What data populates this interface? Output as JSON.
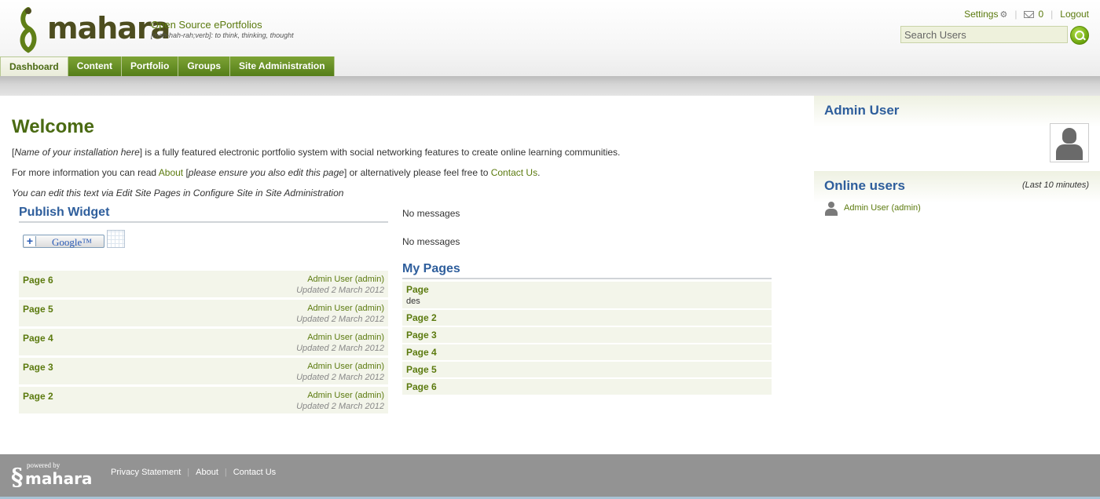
{
  "header": {
    "logo_text": "mahara",
    "tagline_title": "Open Source ePortfolios",
    "tagline_sub": "[mah-hah-rah;verb]: to think, thinking, thought",
    "settings_label": "Settings",
    "inbox_count": "0",
    "logout_label": "Logout",
    "search_placeholder": "Search Users"
  },
  "nav": {
    "tabs": [
      {
        "label": "Dashboard",
        "active": true
      },
      {
        "label": "Content"
      },
      {
        "label": "Portfolio"
      },
      {
        "label": "Groups"
      },
      {
        "label": "Site Administration"
      }
    ]
  },
  "main": {
    "welcome_title": "Welcome",
    "intro1_open": "[",
    "intro1_em": "Name of your installation here",
    "intro1_rest": "] is a fully featured electronic portfolio system with social networking features to create online learning communities.",
    "intro2_start": "For more information you can read ",
    "intro2_about": "About",
    "intro2_bracket_open": " [",
    "intro2_em": "please ensure you also edit this page",
    "intro2_mid": "] or alternatively please feel free to ",
    "intro2_contact": "Contact Us",
    "intro2_end": ".",
    "intro3": "You can edit this text via Edit Site Pages in Configure Site in Site Administration"
  },
  "publish_widget": {
    "title": "Publish Widget",
    "google_text": "Google™",
    "items": [
      {
        "title": "Page 6",
        "author": "Admin User (admin)",
        "updated": "Updated 2 March 2012"
      },
      {
        "title": "Page 5",
        "author": "Admin User (admin)",
        "updated": "Updated 2 March 2012"
      },
      {
        "title": "Page 4",
        "author": "Admin User (admin)",
        "updated": "Updated 2 March 2012"
      },
      {
        "title": "Page 3",
        "author": "Admin User (admin)",
        "updated": "Updated 2 March 2012"
      },
      {
        "title": "Page 2",
        "author": "Admin User (admin)",
        "updated": "Updated 2 March 2012"
      }
    ]
  },
  "right_column": {
    "no_messages_1": "No messages",
    "no_messages_2": "No messages",
    "my_pages_title": "My Pages",
    "pages": [
      {
        "title": "Page",
        "desc": "des"
      },
      {
        "title": "Page 2"
      },
      {
        "title": "Page 3"
      },
      {
        "title": "Page 4"
      },
      {
        "title": "Page 5"
      },
      {
        "title": "Page 6"
      }
    ]
  },
  "sidebar": {
    "profile_title": "Admin User",
    "online_title": "Online users",
    "online_last": "(Last 10 minutes)",
    "online_users": [
      {
        "name": "Admin User (admin)"
      }
    ]
  },
  "footer": {
    "powered_by": "powered by",
    "logo_text": "mahara",
    "links": [
      "Privacy Statement",
      "About",
      "Contact Us"
    ]
  },
  "colors": {
    "brand_green": "#5b7a0e",
    "heading_blue": "#2e5e9c",
    "tab_green": "#6b9226",
    "footer_gray": "#939393"
  }
}
